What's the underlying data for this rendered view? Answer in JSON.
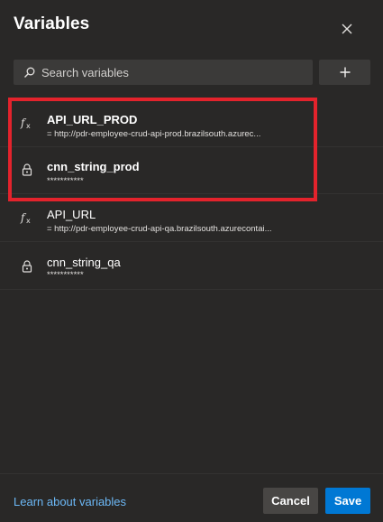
{
  "panel": {
    "title": "Variables",
    "close_icon": "close-icon"
  },
  "search": {
    "placeholder": "Search variables",
    "value": "",
    "icon": "search-icon"
  },
  "add_button": {
    "label": "+"
  },
  "variables": [
    {
      "name": "API_URL_PROD",
      "value": "= http://pdr-employee-crud-api-prod.brazilsouth.azurec...",
      "icon": "function-icon",
      "bold": true
    },
    {
      "name": "cnn_string_prod",
      "value": "***********",
      "icon": "lock-icon",
      "bold": true
    },
    {
      "name": "API_URL",
      "value": "= http://pdr-employee-crud-api-qa.brazilsouth.azurecontai...",
      "icon": "function-icon",
      "bold": false
    },
    {
      "name": "cnn_string_qa",
      "value": "***********",
      "icon": "lock-icon",
      "bold": false
    }
  ],
  "highlight": {
    "color": "#e3232c"
  },
  "footer": {
    "learn_link": "Learn about variables",
    "cancel_label": "Cancel",
    "save_label": "Save"
  },
  "colors": {
    "background": "#292827",
    "input_background": "#3b3a39",
    "primary": "#0078d4",
    "link": "#6cb8f6"
  }
}
